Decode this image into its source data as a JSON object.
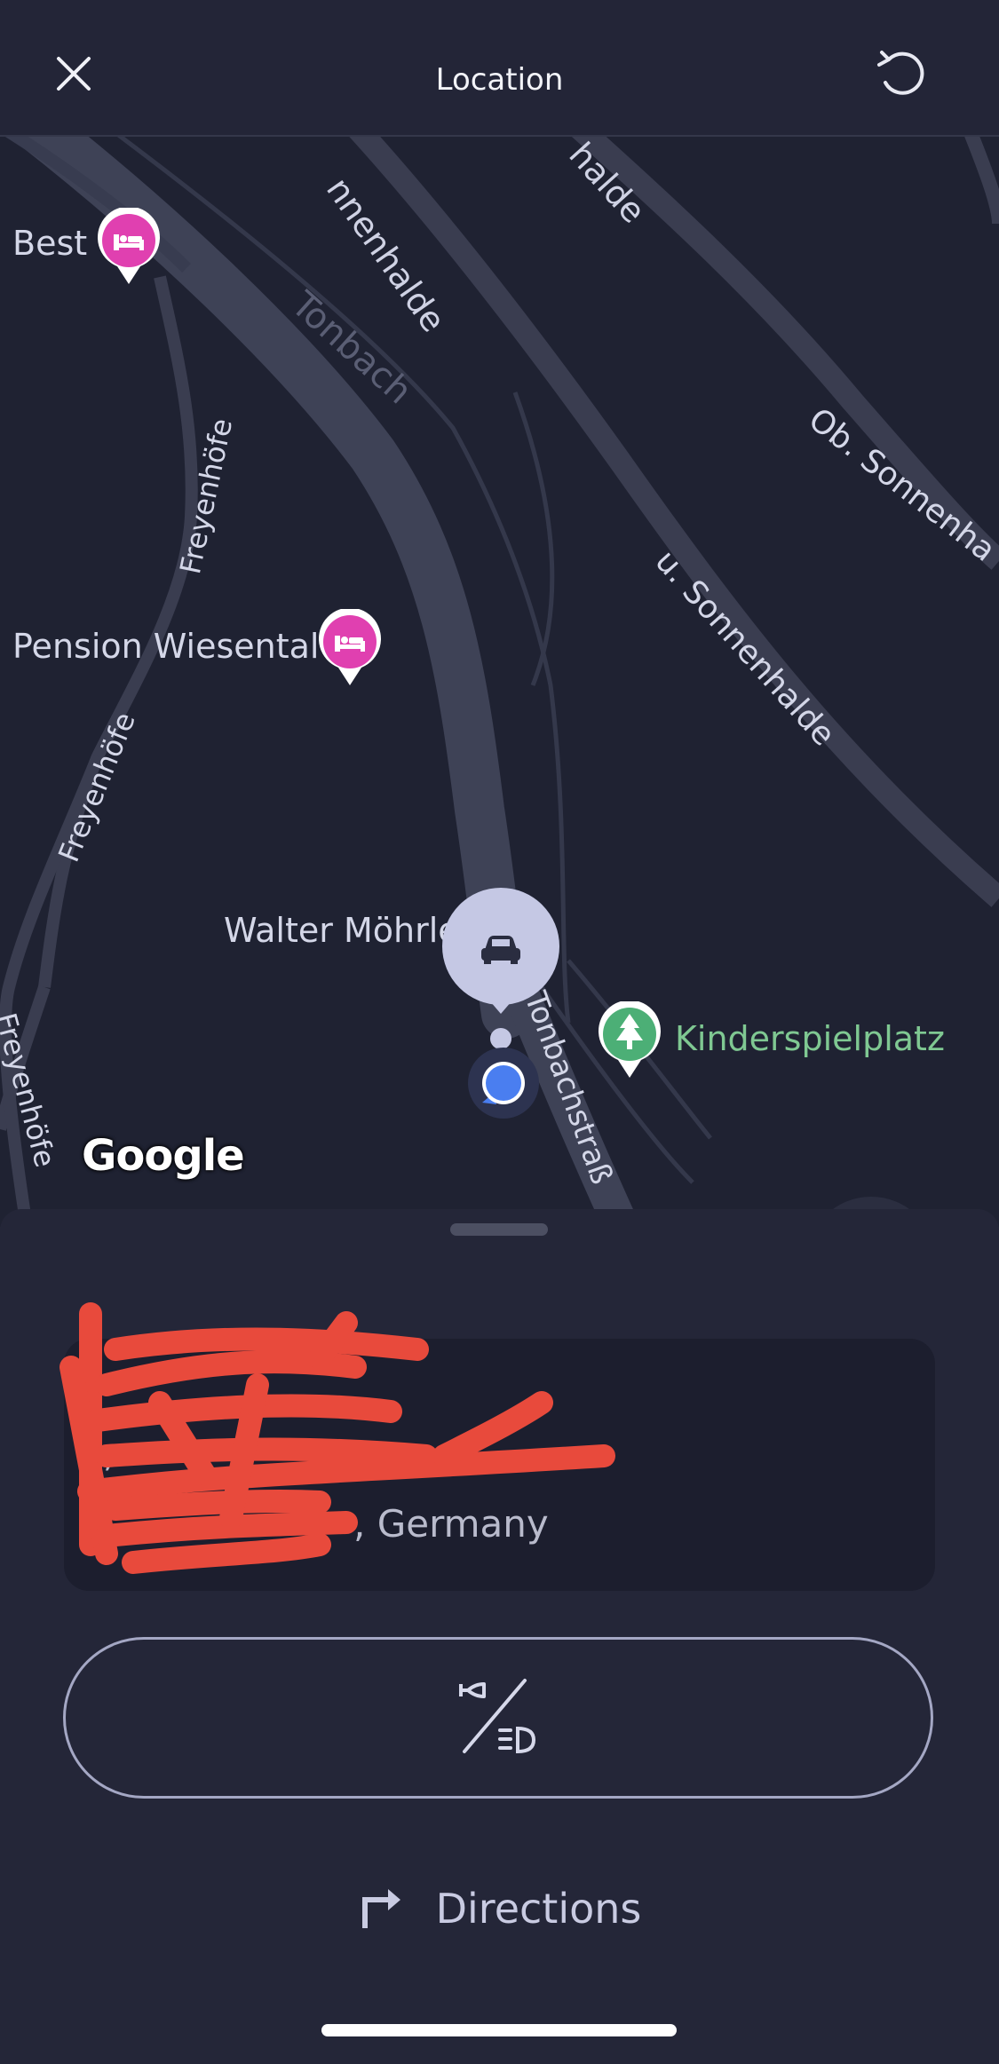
{
  "header": {
    "title": "Location",
    "close_icon": "close-icon",
    "refresh_icon": "refresh-icon"
  },
  "map": {
    "labels": {
      "poi_best": "Best",
      "poi_pension": "Pension Wiesental",
      "poi_walter": "Walter Möhrle",
      "poi_kinder": "Kinderspielplatz",
      "street_sonnenhalde_top": "nnenhalde",
      "street_halde_top": "halde",
      "street_tonbach": "Tonbach",
      "street_freyenhoefe_1": "Freyenhöfe",
      "street_freyenhoefe_2": "Freyenhöfe",
      "street_freyenhoefe_3": "Freyenhöfe",
      "street_ob_sonnenhalde": "Ob. Sonnenha",
      "street_u_sonnenhalde": "u. Sonnenhalde",
      "street_tonbachstrasse": "Tonbachstraß"
    },
    "attribution": "Google",
    "colors": {
      "hotel_pin": "#e040b0",
      "park_pin": "#4caf76",
      "car_bubble": "#c5c8e4",
      "user_dot": "#4a7ef0"
    }
  },
  "sheet": {
    "address_line1": ", ",
    "address_line2": ", Germany",
    "honk_flash_icon": "honk-flash-icon",
    "directions_label": "Directions",
    "directions_icon": "turn-right-arrow-icon"
  }
}
